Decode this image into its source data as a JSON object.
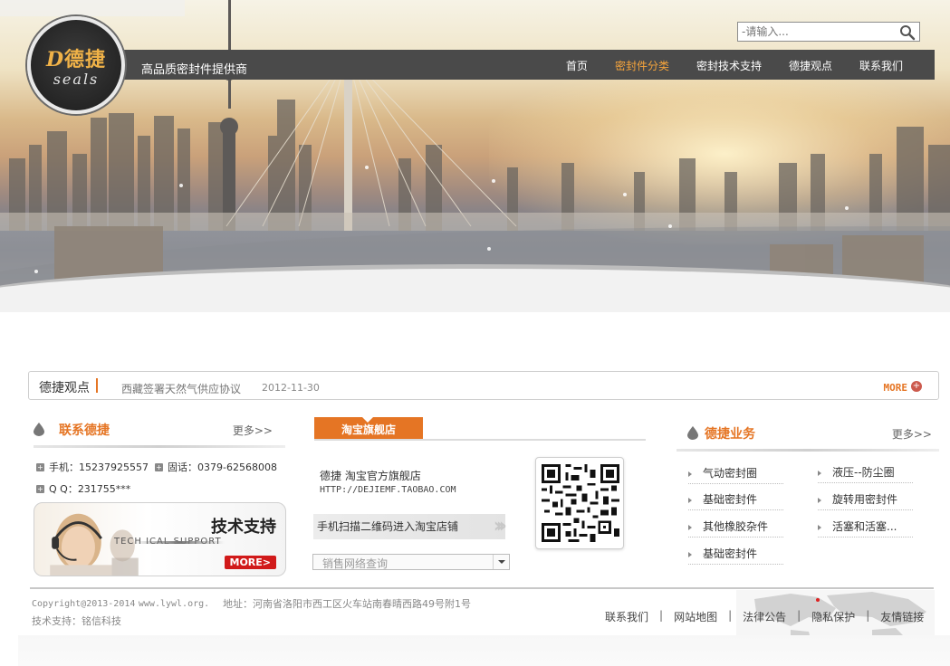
{
  "brand": {
    "logo_chinese": "德捷",
    "logo_letter": "D",
    "logo_sub": "seals",
    "tagline": "高品质密封件提供商"
  },
  "search": {
    "placeholder": "-请输入..."
  },
  "nav": {
    "items": [
      {
        "label": "首页"
      },
      {
        "label": "密封件分类"
      },
      {
        "label": "密封技术支持"
      },
      {
        "label": "德捷观点"
      },
      {
        "label": "联系我们"
      }
    ],
    "active_index": 1
  },
  "news": {
    "title": "德捷观点",
    "item_text": "西藏签署天然气供应协议",
    "item_date": "2012-11-30",
    "more_label": "MORE",
    "more_icon": "+"
  },
  "contact": {
    "title": "联系德捷",
    "more_label": "更多>>",
    "phone": "手机：15237925557",
    "landline": "固话：0379-62568008",
    "qq": "Q Q：231755***",
    "support_banner": {
      "title": "技术支持",
      "subtitle": "TECH        ICAL SUPPORT",
      "more_label": "MORE>"
    }
  },
  "taobao": {
    "tab_label": "淘宝旗舰店",
    "shop_name": "德捷 淘宝官方旗舰店",
    "shop_url": "HTTP://DEJIEMF.TAOBAO.COM",
    "scan_text": "手机扫描二维码进入淘宝店铺",
    "sales_select_value": "销售网络查询"
  },
  "business": {
    "title": "德捷业务",
    "more_label": "更多>>",
    "items": [
      {
        "label": "气动密封圈"
      },
      {
        "label": "液压--防尘圈"
      },
      {
        "label": "基础密封件"
      },
      {
        "label": "旋转用密封件"
      },
      {
        "label": "其他橡胶杂件"
      },
      {
        "label": "活塞和活塞..."
      },
      {
        "label": "基础密封件"
      }
    ]
  },
  "footer": {
    "copyright_prefix": "Copyright@2013-2014",
    "copyright_domain": "www.lywl.org.",
    "address": "地址：河南省洛阳市西工区火车站南春晴西路49号附1号",
    "tech_support": "技术支持：铭信科技",
    "links": [
      {
        "label": "联系我们"
      },
      {
        "label": "网站地图"
      },
      {
        "label": "法律公告"
      },
      {
        "label": "隐私保护"
      },
      {
        "label": "友情链接"
      }
    ],
    "separator": "|"
  },
  "colors": {
    "accent": "#e57524",
    "nav_bg": "#4a4a4a",
    "nav_active": "#f7a53c",
    "more_red": "#d11a1a"
  }
}
